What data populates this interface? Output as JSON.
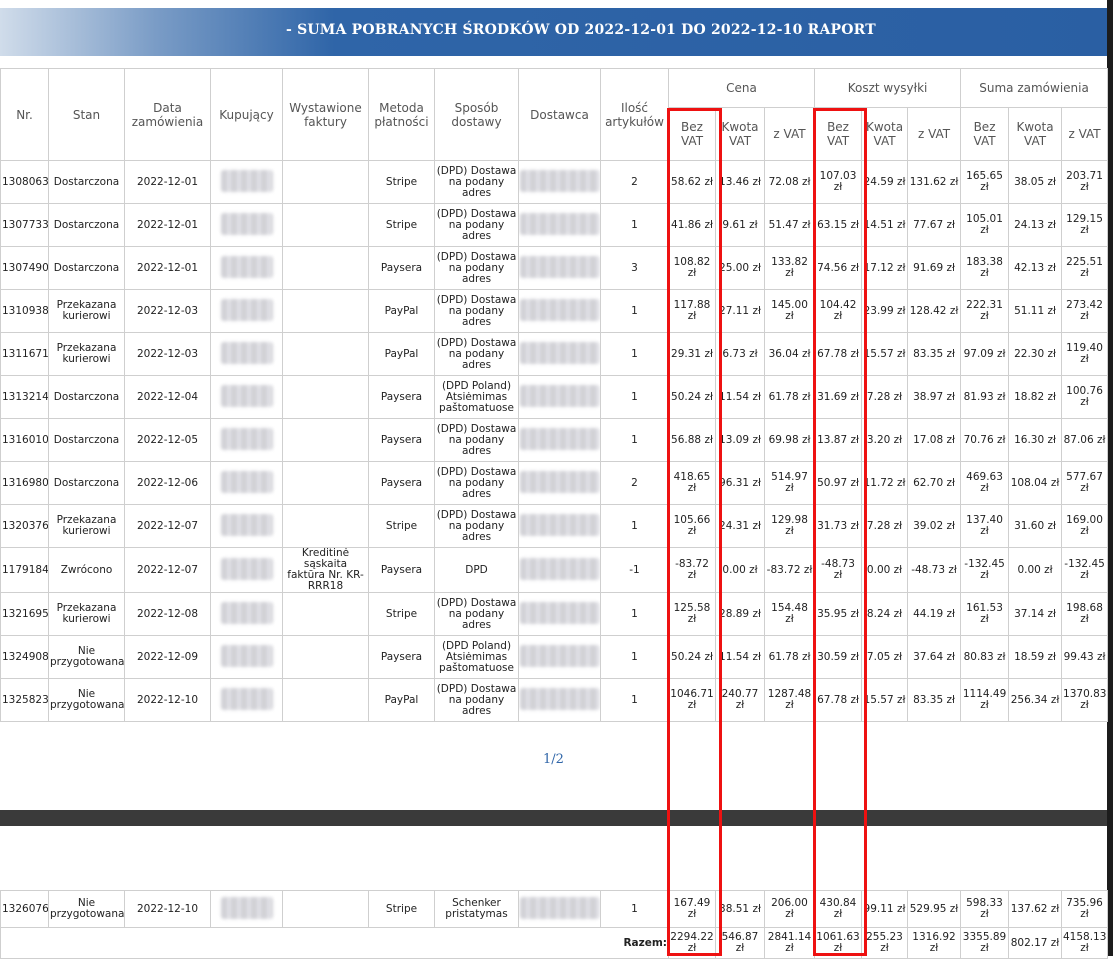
{
  "header": {
    "title": "- SUMA POBRANYCH ŚRODKÓW OD 2022-12-01 DO 2022-12-10 RAPORT"
  },
  "columns": {
    "nr": "Nr.",
    "stan": "Stan",
    "data": "Data zamówienia",
    "kupujacy": "Kupujący",
    "faktury": "Wystawione faktury",
    "metoda": "Metoda płatności",
    "sposob": "Sposób dostawy",
    "dostawca": "Dostawca",
    "ilosc": "Ilość artykułów",
    "groups": {
      "cena": "Cena",
      "koszt": "Koszt wysyłki",
      "suma": "Suma zamówienia"
    },
    "sub": {
      "bez": "Bez VAT",
      "kwota": "Kwota VAT",
      "zvat": "z VAT"
    }
  },
  "rows": [
    {
      "nr": "1308063",
      "stan": "Dostarczona",
      "data": "2022-12-01",
      "faktura": "",
      "metoda": "Stripe",
      "sposob": "(DPD) Dostawa na podany adres",
      "ilosc": "2",
      "cena_bez": "58.62 zł",
      "cena_kwota": "13.46 zł",
      "cena_z": "72.08 zł",
      "koszt_bez": "107.03 zł",
      "koszt_kwota": "24.59 zł",
      "koszt_z": "131.62 zł",
      "suma_bez": "165.65 zł",
      "suma_kwota": "38.05 zł",
      "suma_z": "203.71 zł"
    },
    {
      "nr": "1307733",
      "stan": "Dostarczona",
      "data": "2022-12-01",
      "faktura": "",
      "metoda": "Stripe",
      "sposob": "(DPD) Dostawa na podany adres",
      "ilosc": "1",
      "cena_bez": "41.86 zł",
      "cena_kwota": "9.61 zł",
      "cena_z": "51.47 zł",
      "koszt_bez": "63.15 zł",
      "koszt_kwota": "14.51 zł",
      "koszt_z": "77.67 zł",
      "suma_bez": "105.01 zł",
      "suma_kwota": "24.13 zł",
      "suma_z": "129.15 zł"
    },
    {
      "nr": "1307490",
      "stan": "Dostarczona",
      "data": "2022-12-01",
      "faktura": "",
      "metoda": "Paysera",
      "sposob": "(DPD) Dostawa na podany adres",
      "ilosc": "3",
      "cena_bez": "108.82 zł",
      "cena_kwota": "25.00 zł",
      "cena_z": "133.82 zł",
      "koszt_bez": "74.56 zł",
      "koszt_kwota": "17.12 zł",
      "koszt_z": "91.69 zł",
      "suma_bez": "183.38 zł",
      "suma_kwota": "42.13 zł",
      "suma_z": "225.51 zł"
    },
    {
      "nr": "1310938",
      "stan": "Przekazana kurierowi",
      "data": "2022-12-03",
      "faktura": "",
      "metoda": "PayPal",
      "sposob": "(DPD) Dostawa na podany adres",
      "ilosc": "1",
      "cena_bez": "117.88 zł",
      "cena_kwota": "27.11 zł",
      "cena_z": "145.00 zł",
      "koszt_bez": "104.42 zł",
      "koszt_kwota": "23.99 zł",
      "koszt_z": "128.42 zł",
      "suma_bez": "222.31 zł",
      "suma_kwota": "51.11 zł",
      "suma_z": "273.42 zł"
    },
    {
      "nr": "1311671",
      "stan": "Przekazana kurierowi",
      "data": "2022-12-03",
      "faktura": "",
      "metoda": "PayPal",
      "sposob": "(DPD) Dostawa na podany adres",
      "ilosc": "1",
      "cena_bez": "29.31 zł",
      "cena_kwota": "6.73 zł",
      "cena_z": "36.04 zł",
      "koszt_bez": "67.78 zł",
      "koszt_kwota": "15.57 zł",
      "koszt_z": "83.35 zł",
      "suma_bez": "97.09 zł",
      "suma_kwota": "22.30 zł",
      "suma_z": "119.40 zł"
    },
    {
      "nr": "1313214",
      "stan": "Dostarczona",
      "data": "2022-12-04",
      "faktura": "",
      "metoda": "Paysera",
      "sposob": "(DPD Poland) Atsiėmimas paštomatuose",
      "ilosc": "1",
      "cena_bez": "50.24 zł",
      "cena_kwota": "11.54 zł",
      "cena_z": "61.78 zł",
      "koszt_bez": "31.69 zł",
      "koszt_kwota": "7.28 zł",
      "koszt_z": "38.97 zł",
      "suma_bez": "81.93 zł",
      "suma_kwota": "18.82 zł",
      "suma_z": "100.76 zł"
    },
    {
      "nr": "1316010",
      "stan": "Dostarczona",
      "data": "2022-12-05",
      "faktura": "",
      "metoda": "Paysera",
      "sposob": "(DPD) Dostawa na podany adres",
      "ilosc": "1",
      "cena_bez": "56.88 zł",
      "cena_kwota": "13.09 zł",
      "cena_z": "69.98 zł",
      "koszt_bez": "13.87 zł",
      "koszt_kwota": "3.20 zł",
      "koszt_z": "17.08 zł",
      "suma_bez": "70.76 zł",
      "suma_kwota": "16.30 zł",
      "suma_z": "87.06 zł"
    },
    {
      "nr": "1316980",
      "stan": "Dostarczona",
      "data": "2022-12-06",
      "faktura": "",
      "metoda": "Paysera",
      "sposob": "(DPD) Dostawa na podany adres",
      "ilosc": "2",
      "cena_bez": "418.65 zł",
      "cena_kwota": "96.31 zł",
      "cena_z": "514.97 zł",
      "koszt_bez": "50.97 zł",
      "koszt_kwota": "11.72 zł",
      "koszt_z": "62.70 zł",
      "suma_bez": "469.63 zł",
      "suma_kwota": "108.04 zł",
      "suma_z": "577.67 zł"
    },
    {
      "nr": "1320376",
      "stan": "Przekazana kurierowi",
      "data": "2022-12-07",
      "faktura": "",
      "metoda": "Stripe",
      "sposob": "(DPD) Dostawa na podany adres",
      "ilosc": "1",
      "cena_bez": "105.66 zł",
      "cena_kwota": "24.31 zł",
      "cena_z": "129.98 zł",
      "koszt_bez": "31.73 zł",
      "koszt_kwota": "7.28 zł",
      "koszt_z": "39.02 zł",
      "suma_bez": "137.40 zł",
      "suma_kwota": "31.60 zł",
      "suma_z": "169.00 zł"
    },
    {
      "nr": "1179184",
      "stan": "Zwrócono",
      "data": "2022-12-07",
      "faktura": "Kreditinė sąskaita faktūra Nr. KR-RRR18",
      "metoda": "Paysera",
      "sposob": "DPD",
      "ilosc": "-1",
      "cena_bez": "-83.72 zł",
      "cena_kwota": "0.00 zł",
      "cena_z": "-83.72 zł",
      "koszt_bez": "-48.73 zł",
      "koszt_kwota": "0.00 zł",
      "koszt_z": "-48.73 zł",
      "suma_bez": "-132.45 zł",
      "suma_kwota": "0.00 zł",
      "suma_z": "-132.45 zł"
    },
    {
      "nr": "1321695",
      "stan": "Przekazana kurierowi",
      "data": "2022-12-08",
      "faktura": "",
      "metoda": "Stripe",
      "sposob": "(DPD) Dostawa na podany adres",
      "ilosc": "1",
      "cena_bez": "125.58 zł",
      "cena_kwota": "28.89 zł",
      "cena_z": "154.48 zł",
      "koszt_bez": "35.95 zł",
      "koszt_kwota": "8.24 zł",
      "koszt_z": "44.19 zł",
      "suma_bez": "161.53 zł",
      "suma_kwota": "37.14 zł",
      "suma_z": "198.68 zł"
    },
    {
      "nr": "1324908",
      "stan": "Nie przygotowana",
      "data": "2022-12-09",
      "faktura": "",
      "metoda": "Paysera",
      "sposob": "(DPD Poland) Atsiėmimas paštomatuose",
      "ilosc": "1",
      "cena_bez": "50.24 zł",
      "cena_kwota": "11.54 zł",
      "cena_z": "61.78 zł",
      "koszt_bez": "30.59 zł",
      "koszt_kwota": "7.05 zł",
      "koszt_z": "37.64 zł",
      "suma_bez": "80.83 zł",
      "suma_kwota": "18.59 zł",
      "suma_z": "99.43 zł"
    },
    {
      "nr": "1325823",
      "stan": "Nie przygotowana",
      "data": "2022-12-10",
      "faktura": "",
      "metoda": "PayPal",
      "sposob": "(DPD) Dostawa na podany adres",
      "ilosc": "1",
      "cena_bez": "1046.71 zł",
      "cena_kwota": "240.77 zł",
      "cena_z": "1287.48 zł",
      "koszt_bez": "67.78 zł",
      "koszt_kwota": "15.57 zł",
      "koszt_z": "83.35 zł",
      "suma_bez": "1114.49 zł",
      "suma_kwota": "256.34 zł",
      "suma_z": "1370.83 zł"
    }
  ],
  "pager": "1/2",
  "page2": {
    "row": {
      "nr": "1326076",
      "stan": "Nie przygotowana",
      "data": "2022-12-10",
      "faktura": "",
      "metoda": "Stripe",
      "sposob": "Schenker pristatymas",
      "ilosc": "1",
      "cena_bez": "167.49 zł",
      "cena_kwota": "38.51 zł",
      "cena_z": "206.00 zł",
      "koszt_bez": "430.84 zł",
      "koszt_kwota": "99.11 zł",
      "koszt_z": "529.95 zł",
      "suma_bez": "598.33 zł",
      "suma_kwota": "137.62 zł",
      "suma_z": "735.96 zł"
    },
    "totals": {
      "label": "Razem:",
      "cena_bez": "2294.22 zł",
      "cena_kwota": "546.87 zł",
      "cena_z": "2841.14 zł",
      "koszt_bez": "1061.63 zł",
      "koszt_kwota": "255.23 zł",
      "koszt_z": "1316.92 zł",
      "suma_bez": "3355.89 zł",
      "suma_kwota": "802.17 zł",
      "suma_z": "4158.13 zł"
    }
  },
  "colors": {
    "banner": "#2a5fa3",
    "highlight": "#ee1111",
    "separator": "#3a3a3a"
  }
}
